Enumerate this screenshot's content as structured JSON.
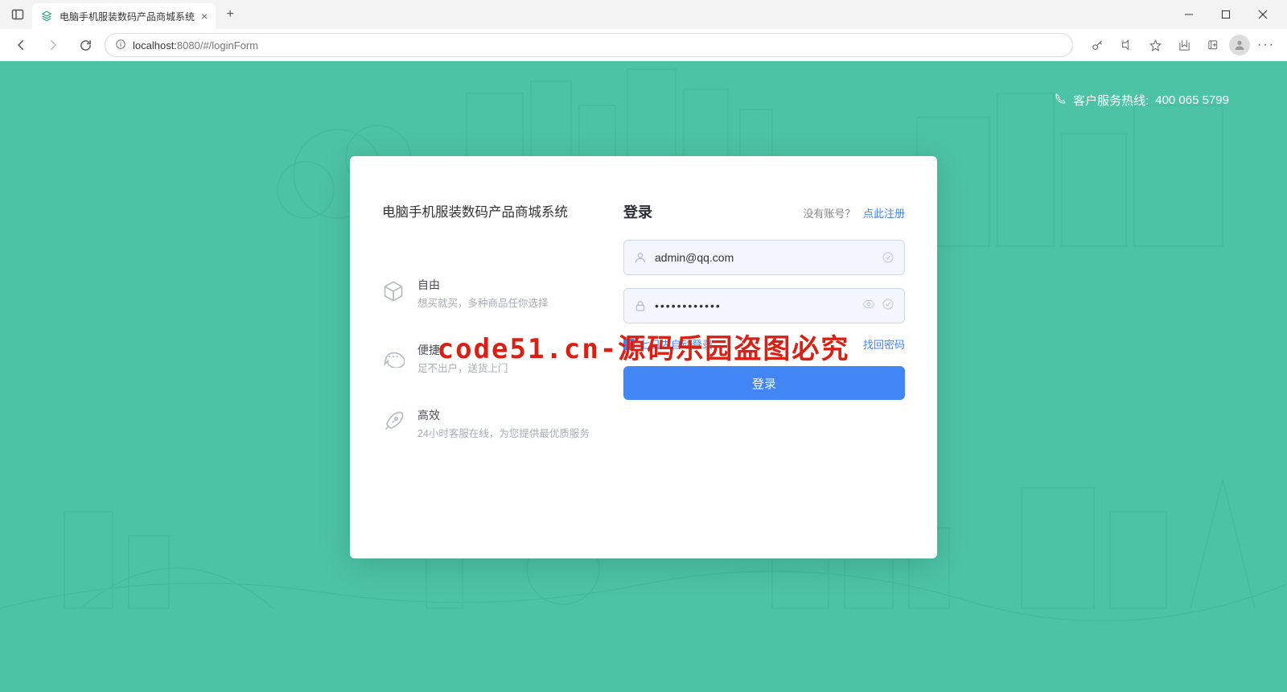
{
  "browser": {
    "tab_title": "电脑手机服装数码产品商城系统",
    "url_host": "localhost:",
    "url_port_path": "8080/#/loginForm"
  },
  "page": {
    "hotline_label": "客户服务热线:",
    "hotline_number": "400 065 5799",
    "system_title": "电脑手机服装数码产品商城系统",
    "features": [
      {
        "title": "自由",
        "desc": "想买就买，多种商品任你选择"
      },
      {
        "title": "便捷",
        "desc": "足不出户，送货上门"
      },
      {
        "title": "高效",
        "desc": "24小时客服在线，为您提供最优质服务"
      }
    ],
    "login": {
      "title": "登录",
      "no_account_text": "没有账号？",
      "register_link": "点此注册",
      "username_value": "admin@qq.com",
      "password_value": "••••••••••••",
      "remember_label": "七日内自动登录",
      "forgot_label": "找回密码",
      "submit_label": "登录"
    },
    "watermark": "code51.cn-源码乐园盗图必究"
  }
}
